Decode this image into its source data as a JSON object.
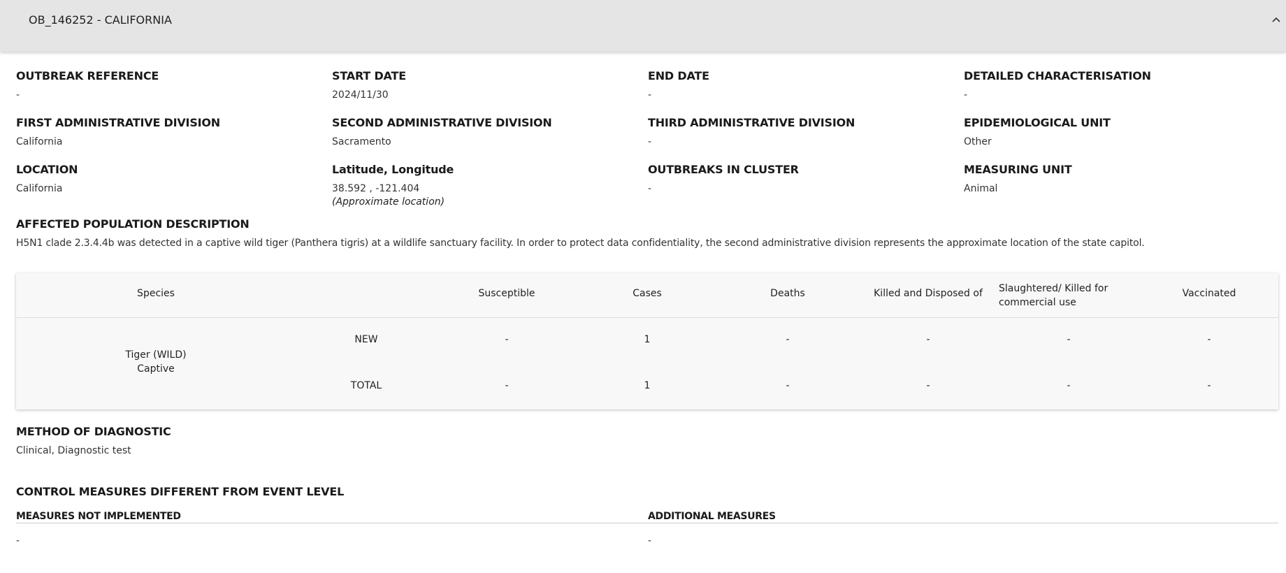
{
  "panel": {
    "title": "OB_146252 - CALIFORNIA"
  },
  "fields": {
    "outbreak_reference": {
      "label": "OUTBREAK REFERENCE",
      "value": "-"
    },
    "start_date": {
      "label": "START DATE",
      "value": "2024/11/30"
    },
    "end_date": {
      "label": "END DATE",
      "value": "-"
    },
    "detailed_characterisation": {
      "label": "DETAILED CHARACTERISATION",
      "value": "-"
    },
    "first_admin_division": {
      "label": "FIRST ADMINISTRATIVE DIVISION",
      "value": "California"
    },
    "second_admin_division": {
      "label": "SECOND ADMINISTRATIVE DIVISION",
      "value": "Sacramento"
    },
    "third_admin_division": {
      "label": "THIRD ADMINISTRATIVE DIVISION",
      "value": "-"
    },
    "epidemiological_unit": {
      "label": "EPIDEMIOLOGICAL UNIT",
      "value": "Other"
    },
    "location": {
      "label": "LOCATION",
      "value": "California"
    },
    "lat_long": {
      "label": "Latitude, Longitude",
      "value": "38.592 , -121.404",
      "note": "(Approximate location)"
    },
    "outbreaks_in_cluster": {
      "label": "OUTBREAKS IN CLUSTER",
      "value": "-"
    },
    "measuring_unit": {
      "label": "MEASURING UNIT",
      "value": "Animal"
    }
  },
  "affected_population": {
    "label": "AFFECTED POPULATION DESCRIPTION",
    "text": "H5N1 clade 2.3.4.4b was detected in a captive wild tiger (Panthera tigris) at a wildlife sanctuary facility. In order to protect data confidentiality, the second administrative division represents the approximate location of the state capitol."
  },
  "species_table": {
    "headers": {
      "species": "Species",
      "susceptible": "Susceptible",
      "cases": "Cases",
      "deaths": "Deaths",
      "killed_disposed": "Killed and Disposed of",
      "slaughtered": "Slaughtered/ Killed for commercial use",
      "vaccinated": "Vaccinated"
    },
    "species_name": "Tiger (WILD)",
    "species_sub": "Captive",
    "rows": [
      {
        "type": "NEW",
        "susceptible": "-",
        "cases": "1",
        "deaths": "-",
        "killed_disposed": "-",
        "slaughtered": "-",
        "vaccinated": "-"
      },
      {
        "type": "TOTAL",
        "susceptible": "-",
        "cases": "1",
        "deaths": "-",
        "killed_disposed": "-",
        "slaughtered": "-",
        "vaccinated": "-"
      }
    ]
  },
  "method_of_diagnostic": {
    "label": "METHOD OF DIAGNOSTIC",
    "value": "Clinical, Diagnostic test"
  },
  "control_measures": {
    "label": "CONTROL MEASURES DIFFERENT FROM EVENT LEVEL",
    "not_implemented": {
      "label": "MEASURES NOT IMPLEMENTED",
      "value": "-"
    },
    "additional": {
      "label": "ADDITIONAL MEASURES",
      "value": "-"
    }
  },
  "icons": {
    "collapse": "chevron-up-icon"
  }
}
